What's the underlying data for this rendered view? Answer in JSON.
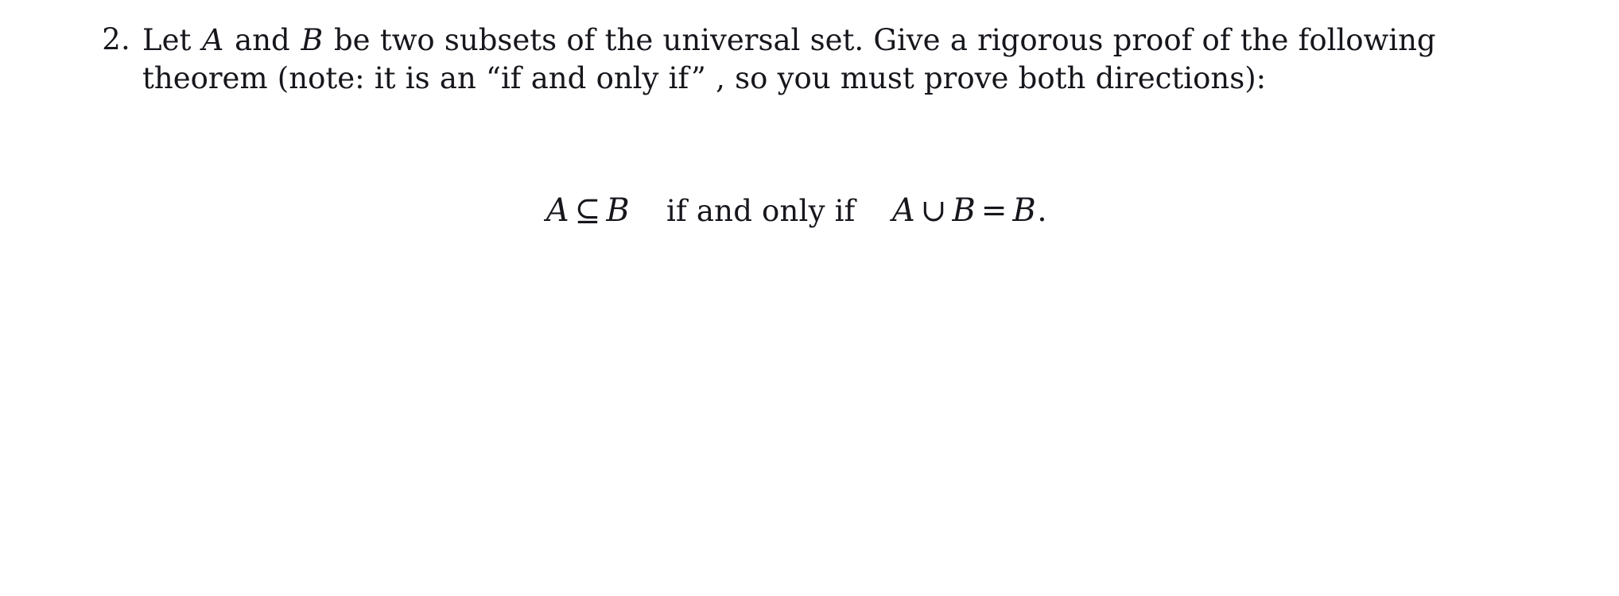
{
  "document": {
    "background_color": "#ffffff",
    "text_color": "#16161c"
  },
  "problem": {
    "number": "2.",
    "line1_part1": "Let ",
    "line1_var_a": "A",
    "line1_part2": " and ",
    "line1_var_b": "B",
    "line1_part3": " be two subsets of the universal set.  Give a rigorous proof of the following",
    "line2": "theorem (note: it is an “if and only if” , so you must prove both directions):"
  },
  "equation": {
    "lhs_left": "A",
    "lhs_operator": "⊆",
    "lhs_right": "B",
    "connective": "if and only if",
    "rhs_left": "A",
    "rhs_operator": "∪",
    "rhs_right": "B",
    "rhs_equals": "=",
    "rhs_result": "B",
    "terminator": "."
  }
}
